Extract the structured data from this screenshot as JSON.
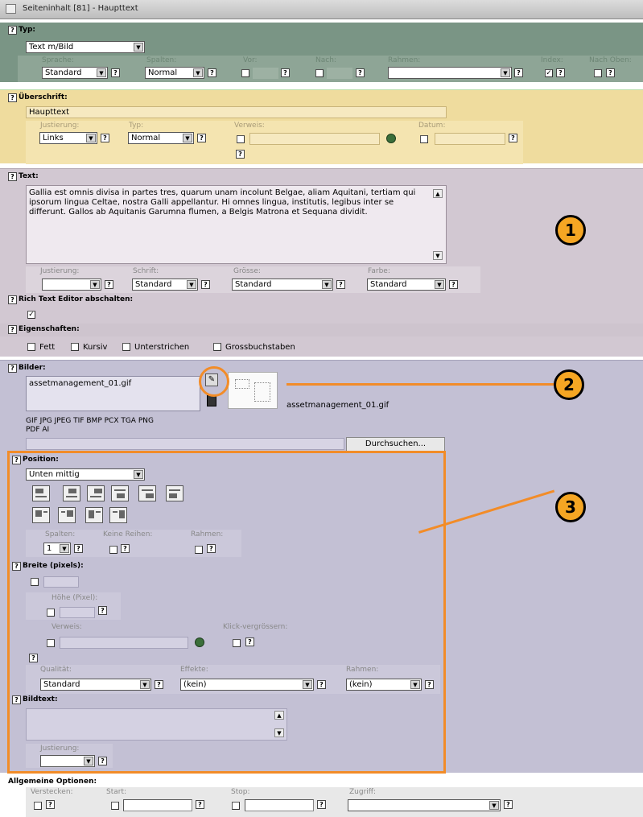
{
  "window": {
    "title": "Seiteninhalt [81] - Haupttext"
  },
  "help_glyph": "?",
  "typ": {
    "header": "Typ:",
    "value": "Text m/Bild",
    "sprache_label": "Sprache:",
    "sprache": "Standard",
    "spalten_label": "Spalten:",
    "spalten": "Normal",
    "vor_label": "Vor:",
    "nach_label": "Nach:",
    "rahmen_label": "Rahmen:",
    "index_label": "Index:",
    "nachoben_label": "Nach Oben:"
  },
  "ueberschrift": {
    "header": "Überschrift:",
    "value": "Haupttext",
    "justierung_label": "Justierung:",
    "justierung": "Links",
    "typ_label": "Typ:",
    "typ": "Normal",
    "verweis_label": "Verweis:",
    "datum_label": "Datum:"
  },
  "text": {
    "header": "Text:",
    "body": "Gallia est omnis divisa in partes tres, quarum unam incolunt Belgae, aliam Aquitani, tertiam qui ipsorum lingua Celtae, nostra Galli appellantur. Hi omnes lingua, institutis, legibus inter se differunt. Gallos ab Aquitanis Garumna flumen, a Belgis Matrona et Sequana dividit.",
    "justierung_label": "Justierung:",
    "schrift_label": "Schrift:",
    "schrift": "Standard",
    "groesse_label": "Grösse:",
    "groesse": "Standard",
    "farbe_label": "Farbe:",
    "farbe": "Standard",
    "rte_header": "Rich Text Editor abschalten:",
    "eigenschaften_header": "Eigenschaften:",
    "fett": "Fett",
    "kursiv": "Kursiv",
    "unterstrichen": "Unterstrichen",
    "gross": "Grossbuchstaben"
  },
  "bilder": {
    "header": "Bilder:",
    "file": "assetmanagement_01.gif",
    "thumb_caption": "assetmanagement_01.gif",
    "formats1": "GIF JPG JPEG TIF BMP PCX TGA PNG",
    "formats2": "PDF AI",
    "browse": "Durchsuchen..."
  },
  "position": {
    "header": "Position:",
    "value": "Unten mittig",
    "spalten_label": "Spalten:",
    "spalten": "1",
    "keine_reihen_label": "Keine Reihen:",
    "rahmen_label": "Rahmen:"
  },
  "breite": {
    "header": "Breite (pixels):",
    "hoehe_label": "Höhe (Pixel):",
    "verweis_label": "Verweis:",
    "klick_label": "Klick-vergrössern:",
    "qualitaet_label": "Qualität:",
    "qualitaet": "Standard",
    "effekte_label": "Effekte:",
    "effekte": "(kein)",
    "rahmen_label": "Rahmen:",
    "rahmen": "(kein)"
  },
  "bildtext": {
    "header": "Bildtext:",
    "justierung_label": "Justierung:"
  },
  "allgemein": {
    "header": "Allgemeine Optionen:",
    "verstecken_label": "Verstecken:",
    "start_label": "Start:",
    "stop_label": "Stop:",
    "zugriff_label": "Zugriff:"
  },
  "callouts": [
    "1",
    "2",
    "3"
  ],
  "colors": {
    "typ_bg": "#7a9585",
    "typ_band": "#8ea596",
    "ueber_bg": "#efdc9e",
    "text_bg": "#d2c8d2",
    "bilder_bg": "#c3c0d4",
    "accent": "#f28c28"
  }
}
